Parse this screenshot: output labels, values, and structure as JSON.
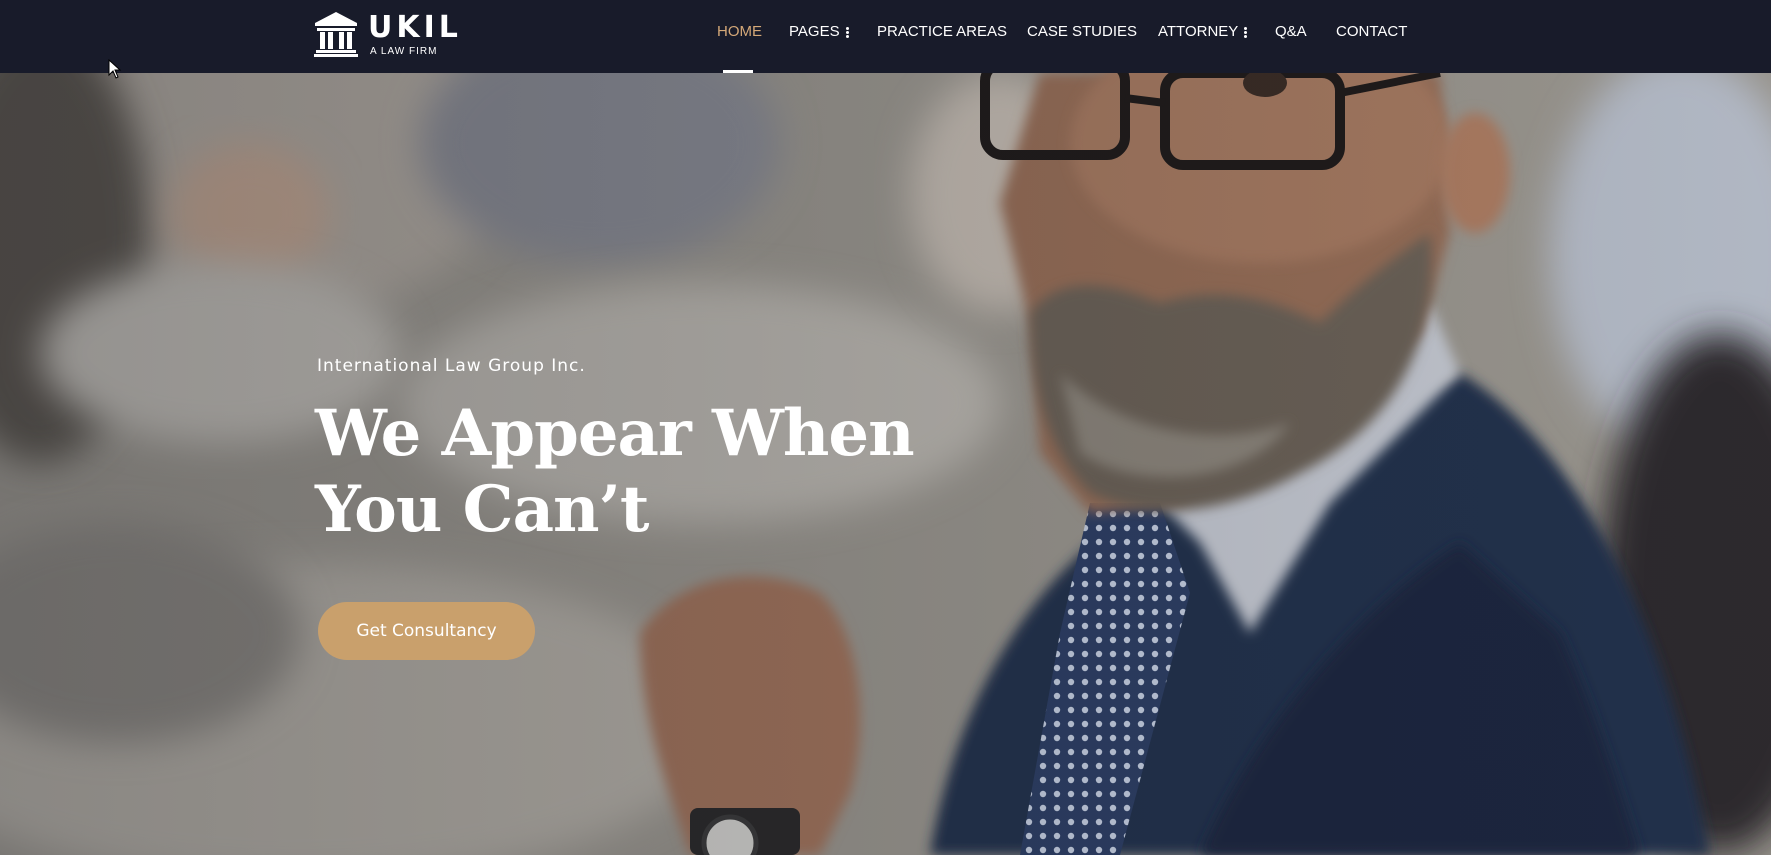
{
  "brand": {
    "name": "UKIL",
    "tagline": "A LAW FIRM",
    "logo_icon": "courthouse-icon"
  },
  "nav": {
    "items": [
      {
        "label": "HOME",
        "active": true,
        "has_submenu": false
      },
      {
        "label": "PAGES",
        "active": false,
        "has_submenu": true
      },
      {
        "label": "PRACTICE AREAS",
        "active": false,
        "has_submenu": false
      },
      {
        "label": "CASE STUDIES",
        "active": false,
        "has_submenu": false
      },
      {
        "label": "ATTORNEY",
        "active": false,
        "has_submenu": true
      },
      {
        "label": "Q&A",
        "active": false,
        "has_submenu": false
      },
      {
        "label": "CONTACT",
        "active": false,
        "has_submenu": false
      }
    ],
    "submenu_icon": "vertical-dots-icon"
  },
  "hero": {
    "eyebrow": "International Law Group Inc.",
    "title_line1": "We Appear When",
    "title_line2": "You Can’t",
    "cta_label": "Get Consultancy",
    "background": "photo-of-bearded-businessman-in-suit-and-glasses"
  },
  "colors": {
    "header_bg": "#181b2a",
    "accent": "#d4a878",
    "button_bg": "#c9a06c",
    "text": "#ffffff"
  }
}
